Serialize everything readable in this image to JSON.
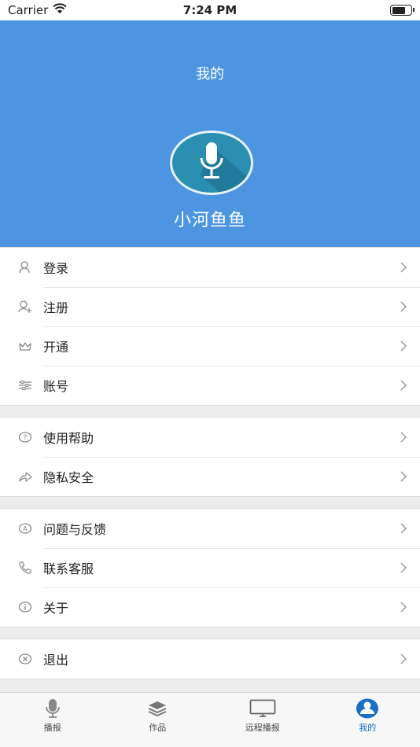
{
  "status_bar": {
    "carrier": "Carrier",
    "time": "7:24 PM"
  },
  "header": {
    "title": "我的",
    "username": "小河鱼鱼"
  },
  "groups": [
    [
      {
        "label": "登录",
        "icon": "user-icon"
      },
      {
        "label": "注册",
        "icon": "user-add-icon"
      },
      {
        "label": "开通",
        "icon": "crown-icon"
      },
      {
        "label": "账号",
        "icon": "sliders-icon"
      }
    ],
    [
      {
        "label": "使用帮助",
        "icon": "help-icon"
      },
      {
        "label": "隐私安全",
        "icon": "share-icon"
      }
    ],
    [
      {
        "label": "问题与反馈",
        "icon": "feedback-icon"
      },
      {
        "label": "联系客服",
        "icon": "phone-icon"
      },
      {
        "label": "关于",
        "icon": "info-icon"
      }
    ],
    [
      {
        "label": "退出",
        "icon": "logout-icon"
      }
    ]
  ],
  "tabbar": [
    {
      "label": "播报",
      "icon": "microphone-icon",
      "active": false
    },
    {
      "label": "作品",
      "icon": "layers-icon",
      "active": false
    },
    {
      "label": "远程播报",
      "icon": "monitor-icon",
      "active": false
    },
    {
      "label": "我的",
      "icon": "profile-icon",
      "active": true
    }
  ],
  "colors": {
    "header_bg": "#4d95e0",
    "active_tab": "#1a6fc4"
  }
}
